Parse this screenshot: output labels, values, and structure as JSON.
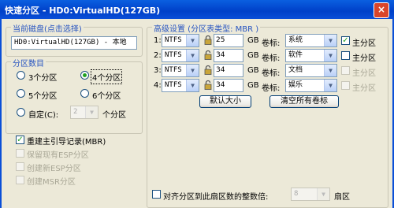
{
  "window": {
    "title": "快速分区 - HD0:VirtualHD(127GB)",
    "close_label": "×"
  },
  "disk_select": {
    "legend": "当前磁盘(点击选择)",
    "value": "HD0:VirtualHD(127GB) - 本地"
  },
  "partition_count": {
    "legend": "分区数目",
    "options": [
      {
        "label": "3个分区",
        "selected": false
      },
      {
        "label": "4个分区",
        "selected": true
      },
      {
        "label": "5个分区",
        "selected": false
      },
      {
        "label": "6个分区",
        "selected": false
      }
    ],
    "custom_label": "自定(C):",
    "custom_value": "2",
    "custom_suffix": "个分区"
  },
  "options": {
    "rebuild_mbr": {
      "label": "重建主引导记录(MBR)",
      "checked": true
    },
    "keep_esp": {
      "label": "保留现有ESP分区",
      "checked": false
    },
    "create_esp": {
      "label": "创建新ESP分区",
      "checked": false
    },
    "create_msr": {
      "label": "创建MSR分区",
      "checked": false
    }
  },
  "advanced": {
    "legend": "高级设置 (分区表类型: MBR )",
    "size_unit": "GB",
    "volume_label_text": "卷标:",
    "primary_label": "主分区",
    "rows": [
      {
        "index": "1:",
        "fs": "NTFS",
        "size": "25",
        "volume": "系统",
        "primary": true
      },
      {
        "index": "2:",
        "fs": "NTFS",
        "size": "34",
        "volume": "软件",
        "primary": false
      },
      {
        "index": "3:",
        "fs": "NTFS",
        "size": "34",
        "volume": "文档",
        "primary": false
      },
      {
        "index": "4:",
        "fs": "NTFS",
        "size": "34",
        "volume": "娱乐",
        "primary": false
      }
    ],
    "default_size_button": "默认大小",
    "clear_labels_button": "清空所有卷标"
  },
  "align": {
    "label": "对齐分区到此扇区数的整数倍:",
    "value": "8",
    "suffix": "扇区",
    "checked": false
  }
}
